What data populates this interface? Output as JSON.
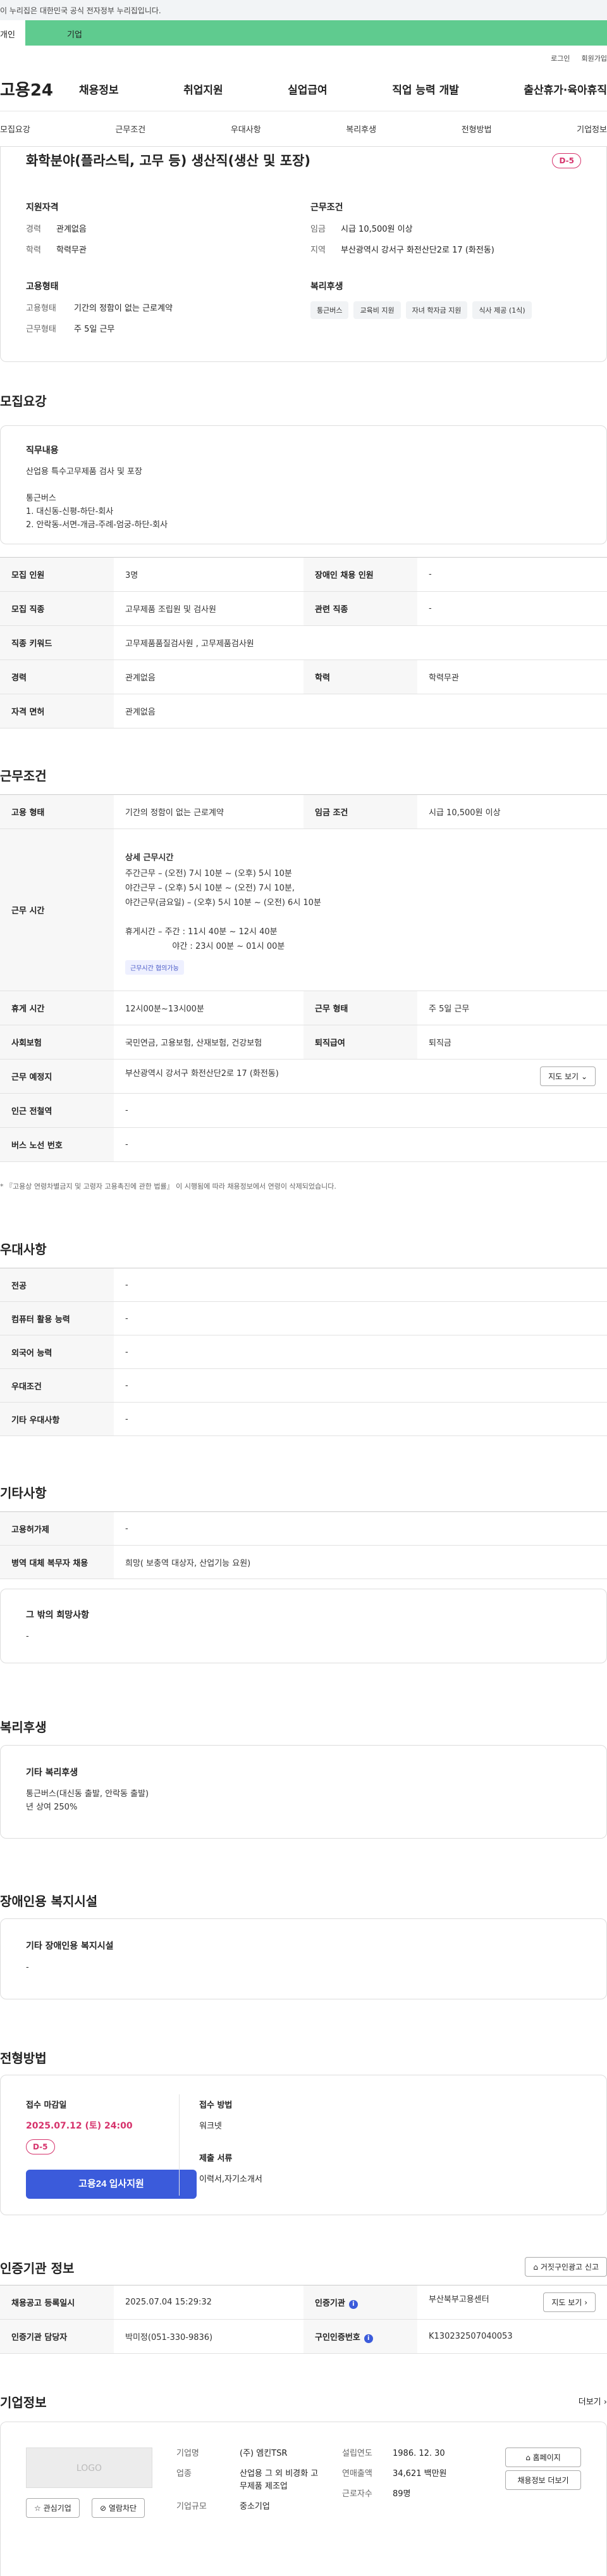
{
  "gov_banner": "이 누리집은 대한민국 공식 전자정부 누리집입니다.",
  "tabs": {
    "person": "개인",
    "company": "기업"
  },
  "util": {
    "login": "로그인",
    "signup": "회원가입"
  },
  "logo": "고용24",
  "gnb": [
    "채용정보",
    "취업지원",
    "실업급여",
    "직업 능력 개발",
    "출산휴가·육아휴직"
  ],
  "subtabs": [
    "모집요강",
    "근무조건",
    "우대사항",
    "복리후생",
    "전형방법",
    "기업정보"
  ],
  "summary": {
    "title": "화학분야(플라스틱, 고무 등) 생산직(생산 및 포장)",
    "dday": "D-5",
    "qual_title": "지원자격",
    "career_k": "경력",
    "career_v": "관계없음",
    "edu_k": "학력",
    "edu_v": "학력무관",
    "cond_title": "근무조건",
    "wage_k": "임금",
    "wage_v": "시급 10,500원 이상",
    "region_k": "지역",
    "region_v": "부산광역시 강서구 화전산단2로 17 (화전동)",
    "emp_title": "고용형태",
    "emptype_k": "고용형태",
    "emptype_v": "기간의 정함이 없는 근로계약",
    "worktype_k": "근무형태",
    "worktype_v": "주 5일 근무",
    "welfare_title": "복리후생",
    "welfare_chips": [
      "통근버스",
      "교육비 지원",
      "자녀 학자금 지원",
      "식사 제공 (1식)"
    ]
  },
  "recruit": {
    "title": "모집요강",
    "duty_title": "직무내용",
    "duty_text": "산업용 특수고무제품 검사 및 포장\n\n통근버스\n1. 대신동-신평-하단-회사\n2. 안락동-서면-개금-주례-엄궁-하단-회사",
    "rows": [
      [
        "모집 인원",
        "3명",
        "장애인 채용 인원",
        "-"
      ],
      [
        "모집 직종",
        "고무제품 조립원 및 검사원",
        "관련 직종",
        "-"
      ],
      [
        "직종 키워드",
        "고무제품품질검사원 , 고무제품검사원"
      ],
      [
        "경력",
        "관계없음",
        "학력",
        "학력무관"
      ],
      [
        "자격 면허",
        "관계없음"
      ]
    ]
  },
  "work": {
    "title": "근무조건",
    "emp_k": "고용 형태",
    "emp_v": "기간의 정함이 없는 근로계약",
    "wage_k": "임금 조건",
    "wage_v": "시급 10,500원 이상",
    "hours_k": "근무 시간",
    "hours_title": "상세 근무시간",
    "hours_text": "주간근무 – (오전) 7시 10분 ~ (오후) 5시 10분\n야간근무 – (오후) 5시 10분 ~ (오전) 7시 10분,\n야간근무(금요일) – (오후) 5시 10분 ~ (오전) 6시 10분\n\n휴게시간 – 주간 : 11시 40분 ~ 12시 40분\n                  야간 : 23시 00분 ~ 01시 00분",
    "hours_tag": "근무시간 협의가능",
    "break_k": "휴게 시간",
    "break_v": "12시00분~13시00분",
    "form_k": "근무 형태",
    "form_v": "주 5일 근무",
    "ins_k": "사회보험",
    "ins_v": "국민연금, 고용보험, 산재보험, 건강보험",
    "retire_k": "퇴직급여",
    "retire_v": "퇴직금",
    "place_k": "근무 예정지",
    "place_v": "부산광역시 강서구 화전산단2로 17 (화전동)",
    "map_btn": "지도 보기",
    "station_k": "인근 전철역",
    "station_v": "-",
    "bus_k": "버스 노선 번호",
    "bus_v": "-",
    "note": "* 『고용상 연령차별금지 및 고령자 고용촉진에 관한 법률』 이 시행됨에 따라 채용정보에서 연령이 삭제되었습니다."
  },
  "pref": {
    "title": "우대사항",
    "rows": [
      [
        "전공",
        "-"
      ],
      [
        "컴퓨터 활용 능력",
        "-"
      ],
      [
        "외국어 능력",
        "-"
      ],
      [
        "우대조건",
        "-"
      ],
      [
        "기타 우대사항",
        "-"
      ]
    ]
  },
  "etc": {
    "title": "기타사항",
    "rows": [
      [
        "고용허가제",
        "-"
      ],
      [
        "병역 대체 복무자 채용",
        "희망( 보충역 대상자, 산업기능 요원)"
      ]
    ],
    "wish_title": "그 밖의 희망사항",
    "wish_text": "-"
  },
  "welfare": {
    "title": "복리후생",
    "box_title": "기타 복리후생",
    "box_text": "통근버스(대신동 출발, 안락동 출발)\n년 상여 250%"
  },
  "disabled": {
    "title": "장애인용 복지시설",
    "box_title": "기타 장애인용 복지시설",
    "box_text": "-"
  },
  "process": {
    "title": "전형방법",
    "deadline_k": "접수 마감일",
    "deadline_v": "2025.07.12 (토) 24:00",
    "dday": "D-5",
    "apply_btn": "고용24 입사지원",
    "method_k": "접수 방법",
    "method_v": "워크넷",
    "docs_k": "제출 서류",
    "docs_v": "이력서,자기소개서"
  },
  "cert": {
    "title": "인증기관 정보",
    "report_btn": "거짓구인광고 신고",
    "reg_k": "채용공고 등록일시",
    "reg_v": "2025.07.04 15:29:32",
    "agency_k": "인증기관",
    "agency_v": "부산북부고용센터",
    "map_btn": "지도 보기",
    "manager_k": "인증기관 담당자",
    "manager_v": "박미정(051-330-9836)",
    "num_k": "구인인증번호",
    "num_v": "K130232507040053"
  },
  "company": {
    "title": "기업정보",
    "more": "더보기",
    "logo_text": "LOGO",
    "fav_btn": "관심기업",
    "block_btn": "열람차단",
    "name_k": "기업명",
    "name_v": "(주) 엠킨TSR",
    "biz_k": "업종",
    "biz_v": "산업용 그 외 비경화 고무제품 제조업",
    "size_k": "기업규모",
    "size_v": "중소기업",
    "founded_k": "설립연도",
    "founded_v": "1986. 12. 30",
    "sales_k": "연매출액",
    "sales_v": "34,621 백만원",
    "emp_k": "근로자수",
    "emp_v": "89명",
    "home_btn": "홈페이지",
    "jobs_btn": "채용정보 더보기"
  }
}
